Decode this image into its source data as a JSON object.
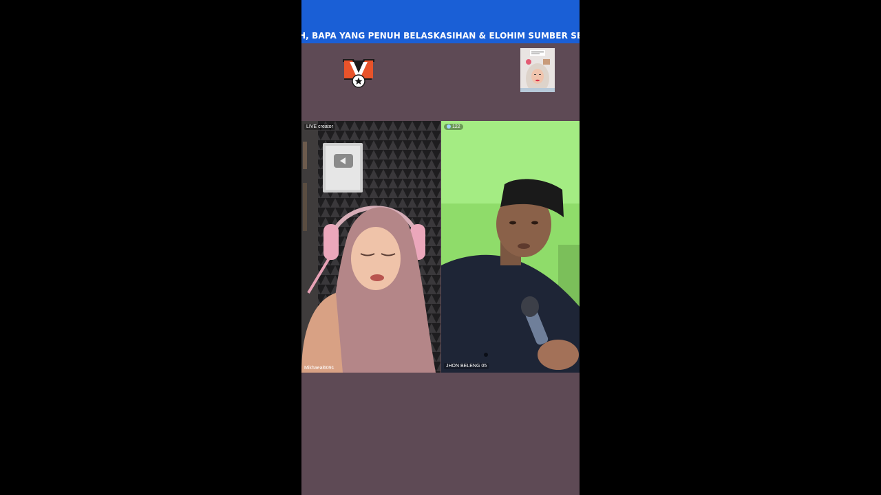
{
  "banner": {
    "ticker_text": "H, BAPA YANG PENUH BELASKASIHAN & ELOHIM SUMBER SEGALA PI",
    "color": "#1a5fd6"
  },
  "layout_colors": {
    "background": "#5e4a55",
    "letterbox": "#000000"
  },
  "left_stream": {
    "live_tag": "LIVE creator",
    "username": "Mikhaeal6091"
  },
  "right_stream": {
    "viewer_count": "122",
    "username": "JHON BELENG 05"
  },
  "icons": {
    "logo": "medal-logo-icon",
    "viewer": "eye-icon"
  }
}
